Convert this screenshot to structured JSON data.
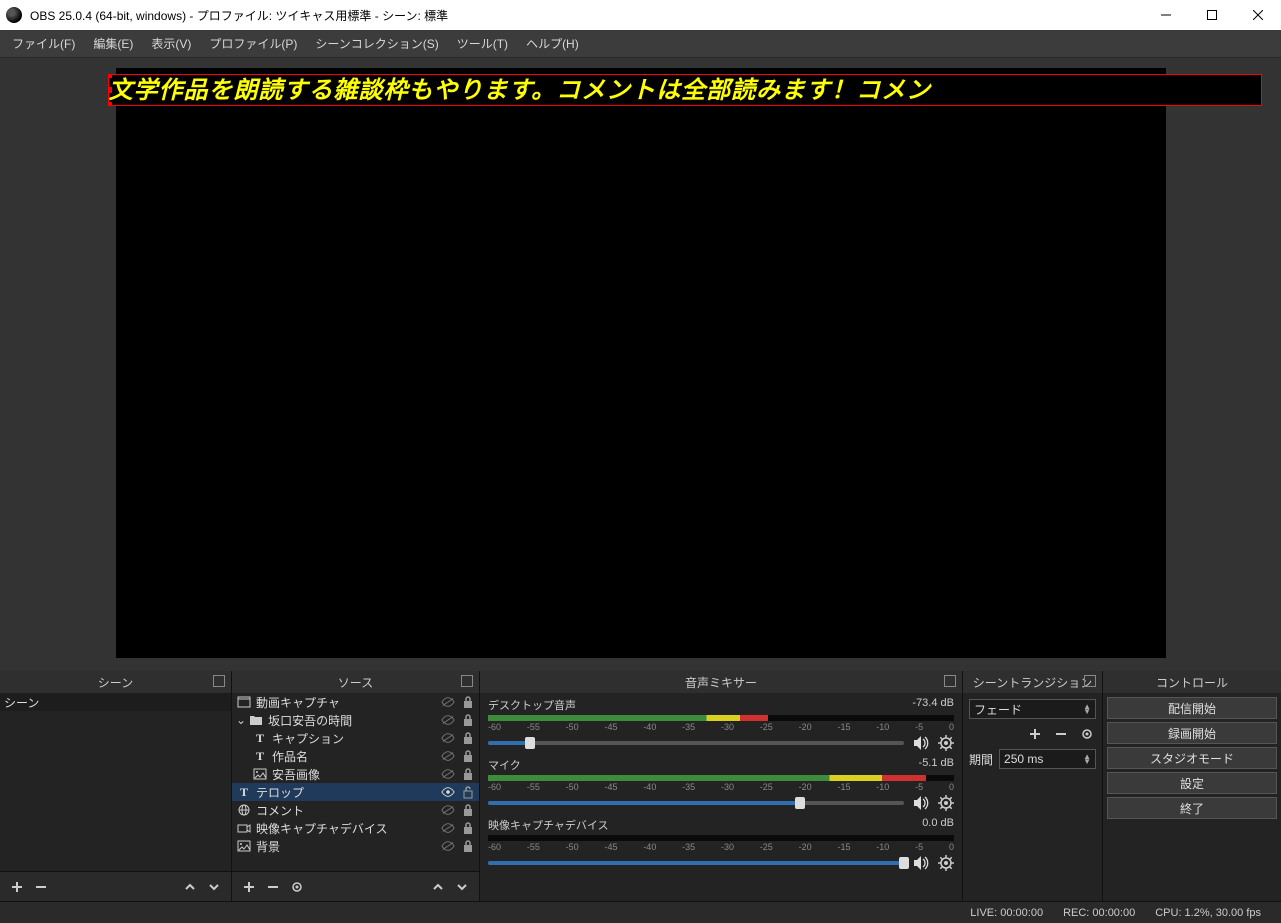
{
  "title": "OBS 25.0.4 (64-bit, windows) - プロファイル: ツイキャス用標準 - シーン: 標準",
  "menu": {
    "file": "ファイル(F)",
    "edit": "編集(E)",
    "view": "表示(V)",
    "profile": "プロファイル(P)",
    "scenecol": "シーンコレクション(S)",
    "tools": "ツール(T)",
    "help": "ヘルプ(H)"
  },
  "ticker_text": "文学作品を朗読する雑談枠もやります。コメントは全部読みます！コメン",
  "panels": {
    "scenes": "シーン",
    "sources": "ソース",
    "mixer": "音声ミキサー",
    "transitions": "シーントランジション",
    "controls": "コントロール"
  },
  "scenes": [
    {
      "name": "シーン"
    }
  ],
  "sources": [
    {
      "indent": 0,
      "icon": "window",
      "label": "動画キャプチャ",
      "vis": false,
      "lock": true
    },
    {
      "indent": 0,
      "icon": "folder",
      "label": "坂口安吾の時間",
      "vis": false,
      "lock": true,
      "expand": true
    },
    {
      "indent": 1,
      "icon": "text",
      "label": "キャプション",
      "vis": false,
      "lock": true
    },
    {
      "indent": 1,
      "icon": "text",
      "label": "作品名",
      "vis": false,
      "lock": true
    },
    {
      "indent": 1,
      "icon": "image",
      "label": "安吾画像",
      "vis": false,
      "lock": true
    },
    {
      "indent": 0,
      "icon": "text",
      "label": "テロップ",
      "vis": true,
      "lock": false,
      "selected": true
    },
    {
      "indent": 0,
      "icon": "globe",
      "label": "コメント",
      "vis": false,
      "lock": true
    },
    {
      "indent": 0,
      "icon": "camera",
      "label": "映像キャプチャデバイス",
      "vis": false,
      "lock": true
    },
    {
      "indent": 0,
      "icon": "image",
      "label": "背景",
      "vis": false,
      "lock": true
    }
  ],
  "mixer": [
    {
      "name": "デスクトップ音声",
      "db": "-73.4 dB",
      "level": 60,
      "vol": 10
    },
    {
      "name": "マイク",
      "db": "-5.1 dB",
      "level": 94,
      "vol": 75
    },
    {
      "name": "映像キャプチャデバイス",
      "db": "0.0 dB",
      "level": 0,
      "vol": 100
    }
  ],
  "scale": [
    "-60",
    "-55",
    "-50",
    "-45",
    "-40",
    "-35",
    "-30",
    "-25",
    "-20",
    "-15",
    "-10",
    "-5",
    "0"
  ],
  "transition": {
    "mode": "フェード",
    "dur_label": "期間",
    "dur": "250 ms"
  },
  "controls": {
    "start_stream": "配信開始",
    "start_rec": "録画開始",
    "studio": "スタジオモード",
    "settings": "設定",
    "exit": "終了"
  },
  "status": {
    "live": "LIVE: 00:00:00",
    "rec": "REC: 00:00:00",
    "cpu": "CPU: 1.2%, 30.00 fps"
  }
}
